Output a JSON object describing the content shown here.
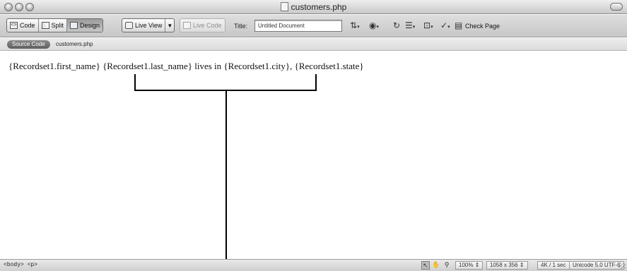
{
  "window": {
    "title": "customers.php"
  },
  "toolbar": {
    "code_label": "Code",
    "split_label": "Split",
    "design_label": "Design",
    "live_view_label": "Live View",
    "live_code_label": "Live Code",
    "title_label": "Title:",
    "title_value": "Untitled Document",
    "check_page_label": "Check Page",
    "active_view": "Design"
  },
  "related_files": {
    "source_label": "Source Code",
    "file": "customers.php"
  },
  "document": {
    "fields": {
      "first_name": "{Recordset1.first_name}",
      "last_name": "{Recordset1.last_name}",
      "lives_in": "lives in",
      "city": "{Recordset1.city}",
      "comma": ",",
      "state": "{Recordset1.state}"
    }
  },
  "status_bar": {
    "tag_selector": "<body> <p>",
    "zoom": "100%",
    "window_size": "1058 x 356",
    "download_stats": "4K / 1 sec",
    "encoding": "Unicode 5.0 UTF-8"
  },
  "icons": {
    "traffic_lights": "traffic-light-icons",
    "file_management": "file-management-icon",
    "preview": "preview-globe-icon",
    "refresh": "refresh-icon",
    "view_options": "view-options-icon",
    "visual_aids": "visual-aids-icon",
    "validate": "validate-markup-icon",
    "browser_check": "browser-check-icon"
  },
  "colors": {
    "chrome": "#d2d2d2",
    "active_button": "#a8a8a8",
    "source_pill": "#707070",
    "callout_line": "#000000"
  }
}
